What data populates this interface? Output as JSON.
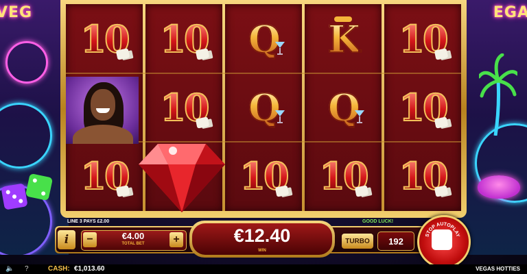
{
  "reels": [
    [
      "10",
      "portrait",
      "10"
    ],
    [
      "10",
      "10",
      "ruby"
    ],
    [
      "Q",
      "Q",
      "10"
    ],
    [
      "K",
      "Q",
      "10"
    ],
    [
      "10",
      "10",
      "10"
    ]
  ],
  "side_signs": {
    "left": "VEG",
    "right": "EGA"
  },
  "info": {
    "line_text": "LINE 3 PAYS £2.00",
    "message": "GOOD LUCK!"
  },
  "controls": {
    "info_label": "i",
    "minus_label": "−",
    "plus_label": "+",
    "bet_value": "€4.00",
    "bet_label": "TOTAL BET",
    "win_value": "€12.40",
    "win_label": "WIN",
    "turbo_label": "TURBO",
    "autoplay_remaining": "192",
    "autoplay_label": "STOP AUTOPLAY"
  },
  "status_bar": {
    "sound_icon": "speaker-icon",
    "help_label": "?",
    "cash_label": "CASH:",
    "cash_value": "€1,013.60",
    "game_name": "VEGAS HOTTIES"
  },
  "colors": {
    "gold": "#f5b53a",
    "red": "#a01818",
    "neon_blue": "#3ad5ff",
    "neon_pink": "#ff2fb5"
  }
}
